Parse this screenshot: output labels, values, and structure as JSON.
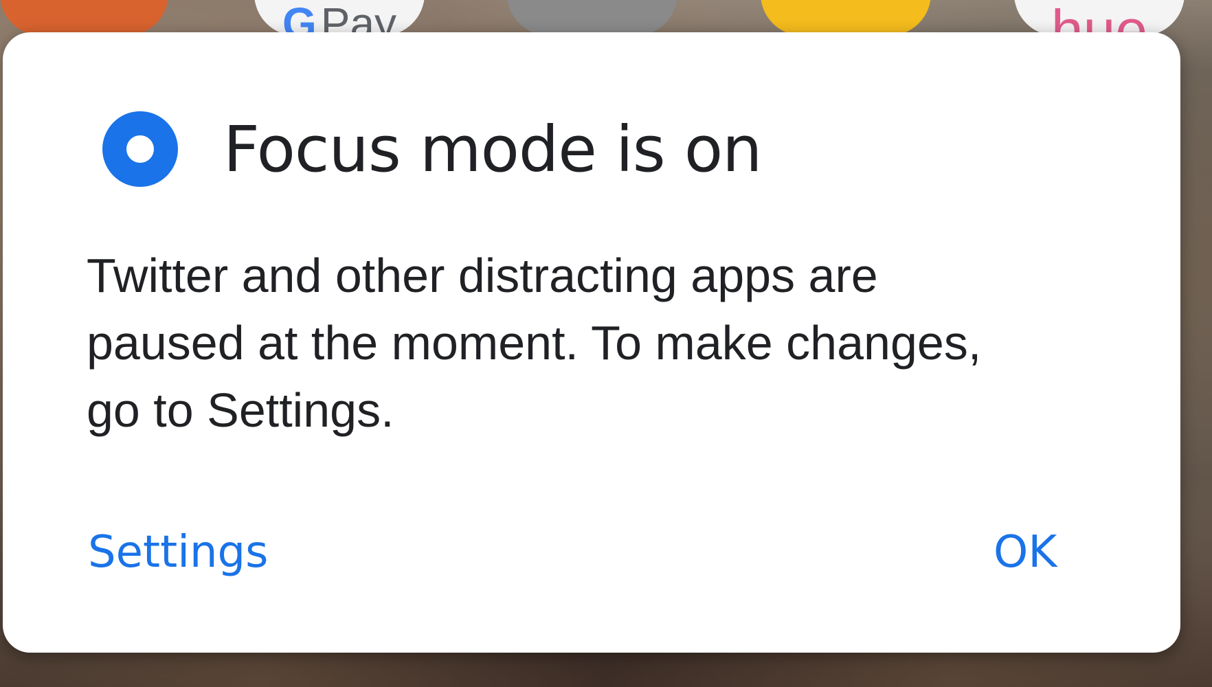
{
  "background_apps": {
    "gpay_label": "Pay",
    "gpay_g": "G",
    "hue_label": "hue"
  },
  "dialog": {
    "icon": "focus-mode-icon",
    "title": "Focus mode is on",
    "message": "Twitter and other distracting apps are paused at the moment. To make changes, go to Settings.",
    "settings_button": "Settings",
    "ok_button": "OK"
  },
  "colors": {
    "accent": "#1a73e8",
    "text": "#202124",
    "dialog_bg": "#ffffff"
  }
}
